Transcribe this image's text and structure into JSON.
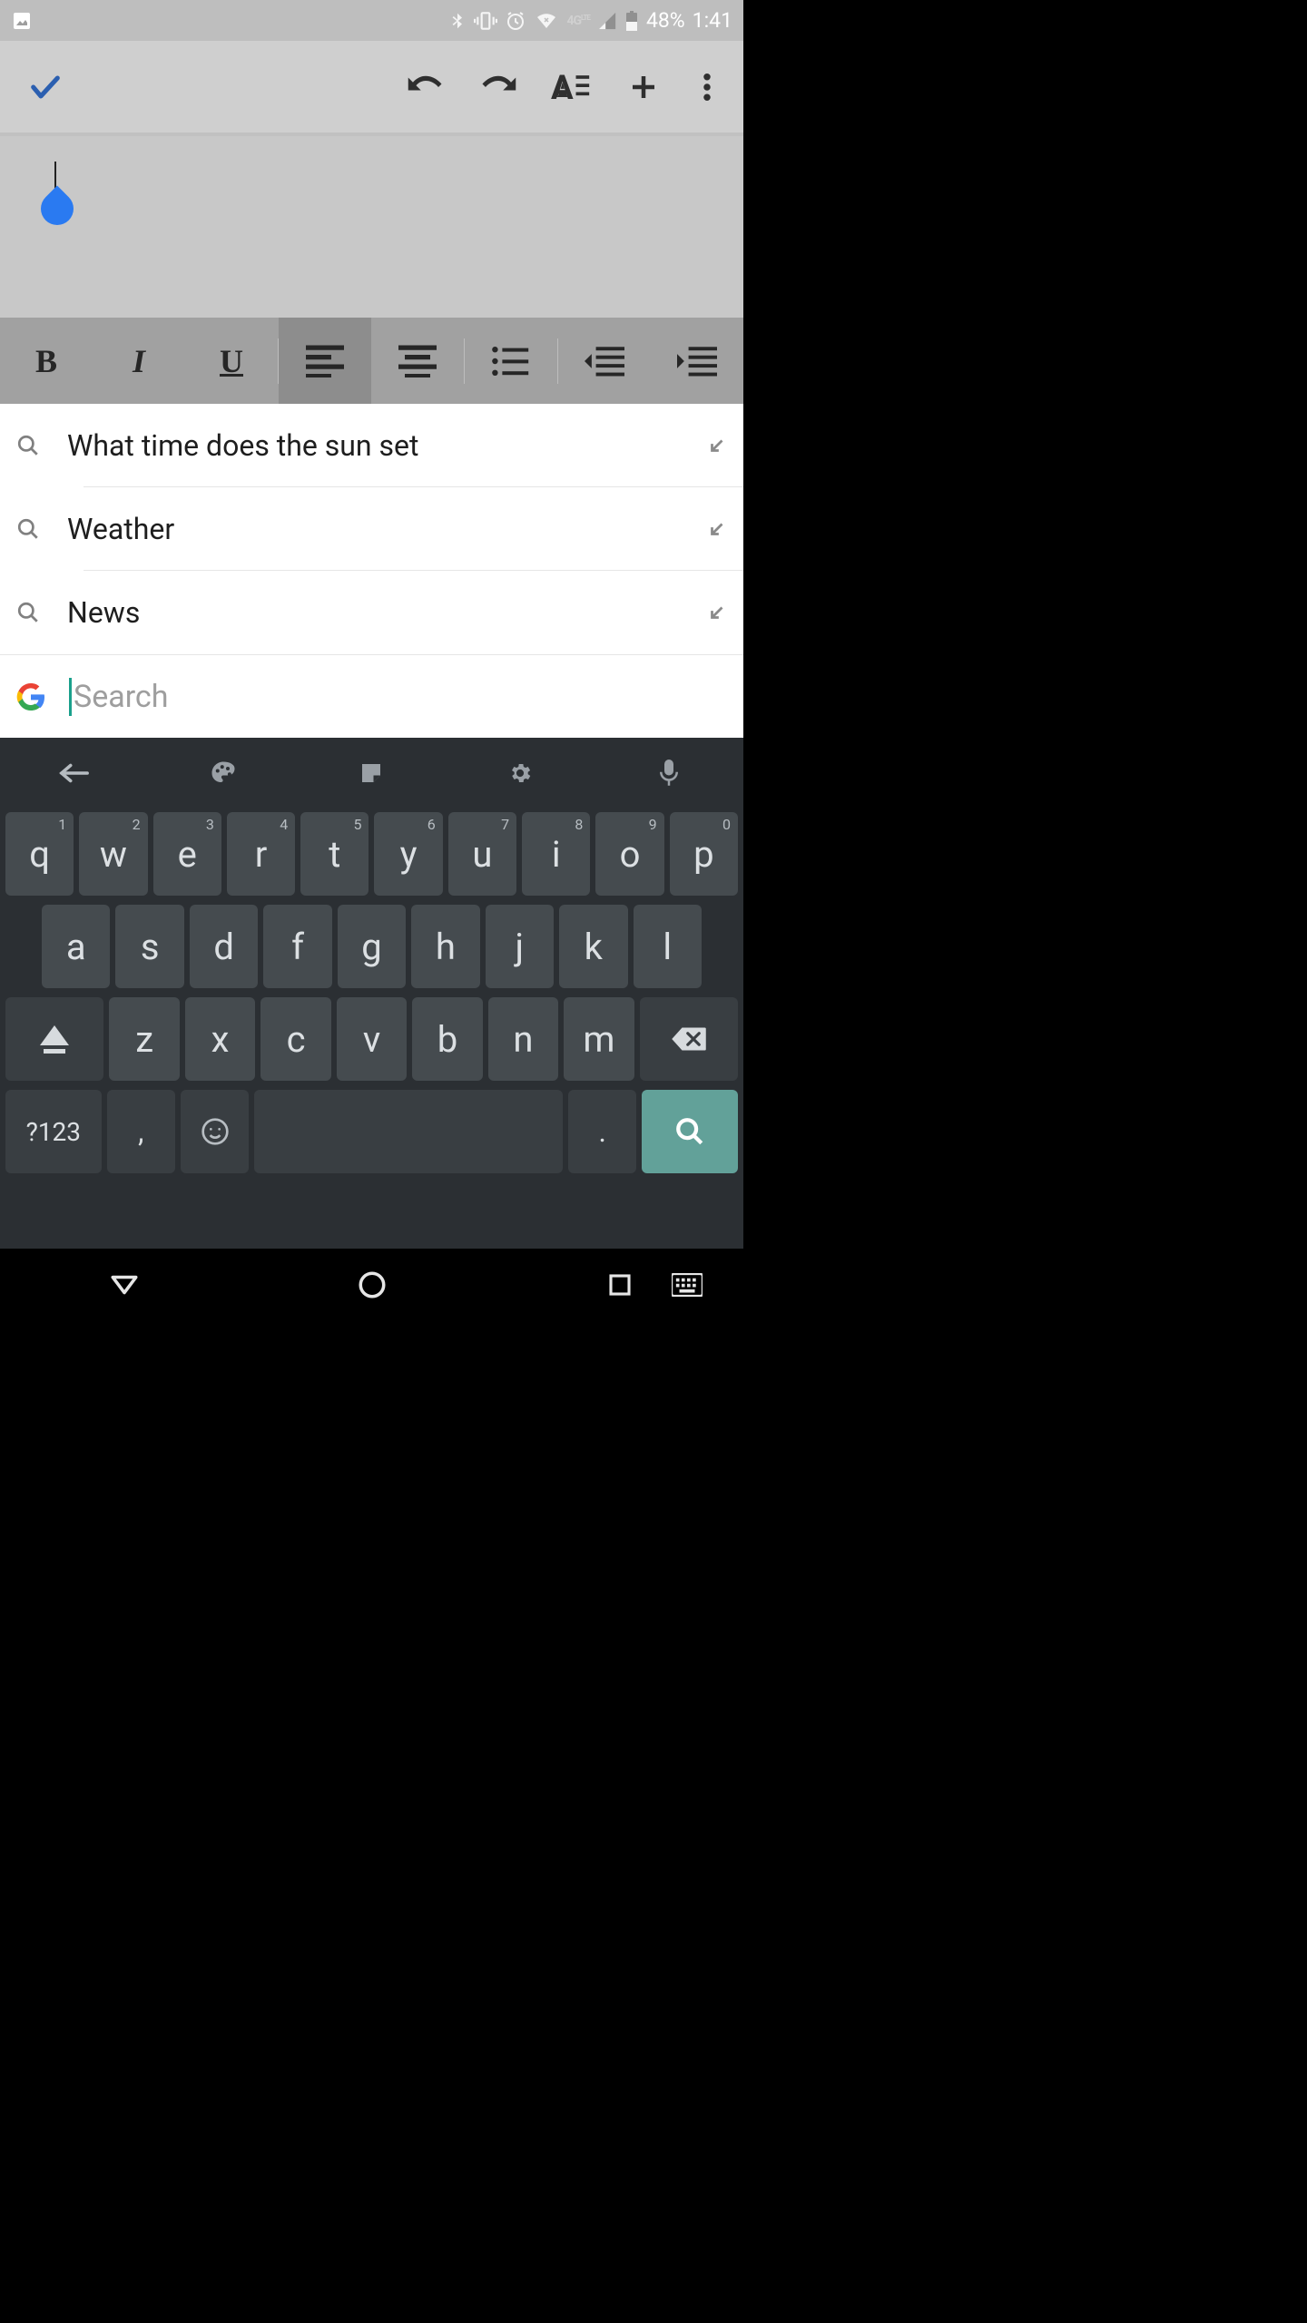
{
  "status": {
    "battery_percent": "48%",
    "time": "1:41"
  },
  "suggestions": [
    {
      "text": "What time does the sun set"
    },
    {
      "text": "Weather"
    },
    {
      "text": "News"
    }
  ],
  "search": {
    "placeholder": "Search"
  },
  "keyboard": {
    "row1": [
      {
        "k": "q",
        "n": "1"
      },
      {
        "k": "w",
        "n": "2"
      },
      {
        "k": "e",
        "n": "3"
      },
      {
        "k": "r",
        "n": "4"
      },
      {
        "k": "t",
        "n": "5"
      },
      {
        "k": "y",
        "n": "6"
      },
      {
        "k": "u",
        "n": "7"
      },
      {
        "k": "i",
        "n": "8"
      },
      {
        "k": "o",
        "n": "9"
      },
      {
        "k": "p",
        "n": "0"
      }
    ],
    "row2": [
      {
        "k": "a"
      },
      {
        "k": "s"
      },
      {
        "k": "d"
      },
      {
        "k": "f"
      },
      {
        "k": "g"
      },
      {
        "k": "h"
      },
      {
        "k": "j"
      },
      {
        "k": "k"
      },
      {
        "k": "l"
      }
    ],
    "row3_mid": [
      {
        "k": "z"
      },
      {
        "k": "x"
      },
      {
        "k": "c"
      },
      {
        "k": "v"
      },
      {
        "k": "b"
      },
      {
        "k": "n"
      },
      {
        "k": "m"
      }
    ],
    "sym": "?123",
    "comma": ",",
    "dot": "."
  }
}
